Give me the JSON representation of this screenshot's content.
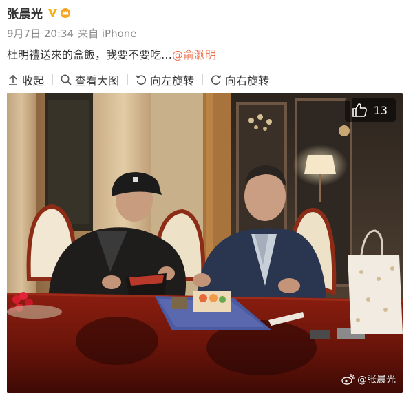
{
  "post": {
    "author": "张晨光",
    "time": "9月7日 20:34",
    "source": "来自 iPhone",
    "text": "杜明禮送來的盒飯，我要不要吃…",
    "mention": "@俞灏明"
  },
  "toolbar": {
    "collapse_label": "收起",
    "view_large_label": "查看大图",
    "rotate_left_label": "向左旋转",
    "rotate_right_label": "向右旋转"
  },
  "photo": {
    "like_count": "13",
    "watermark": "@张晨光"
  },
  "colors": {
    "accent_orange": "#eb7350",
    "verified_gold": "#f5b21c",
    "text_gray": "#888888"
  },
  "icons": {
    "verified": "verified-v-icon",
    "vip": "vip-crown-icon",
    "collapse": "arrow-up-icon",
    "view": "magnifier-icon",
    "rotate_left": "rotate-left-icon",
    "rotate_right": "rotate-right-icon",
    "like": "thumbs-up-icon",
    "weibo": "weibo-logo-icon"
  }
}
